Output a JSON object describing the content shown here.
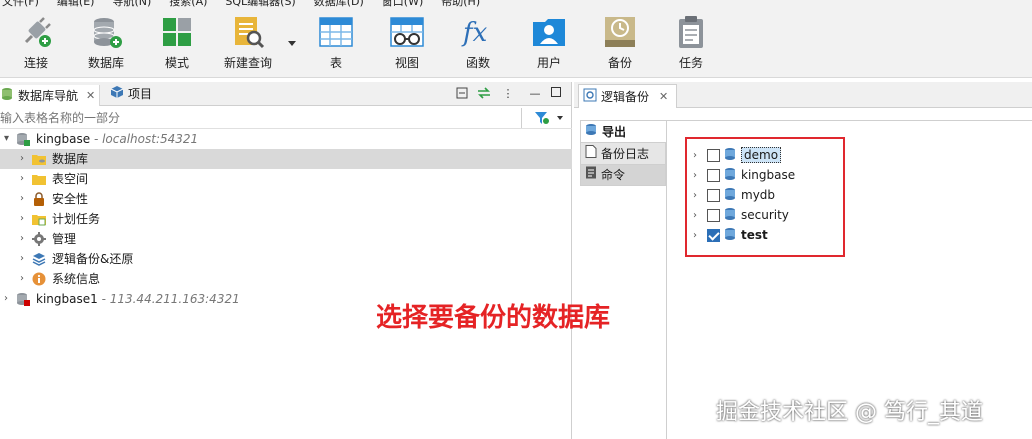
{
  "menubar": {
    "items": [
      "文件(F)",
      "编辑(E)",
      "导航(N)",
      "搜索(A)",
      "SQL编辑器(S)",
      "数据库(D)",
      "窗口(W)",
      "帮助(H)"
    ]
  },
  "toolbar": {
    "connect": "连接",
    "database": "数据库",
    "schema": "模式",
    "new_query": "新建查询",
    "table": "表",
    "view": "视图",
    "function": "函数",
    "user": "用户",
    "backup": "备份",
    "task": "任务"
  },
  "navigator": {
    "tab_label": "数据库导航",
    "tab2_label": "项目",
    "filter_placeholder": "输入表格名称的一部分",
    "tree": [
      {
        "label": "kingbase",
        "host": " - localhost:54321"
      },
      {
        "label": "数据库"
      },
      {
        "label": "表空间"
      },
      {
        "label": "安全性"
      },
      {
        "label": "计划任务"
      },
      {
        "label": "管理"
      },
      {
        "label": "逻辑备份&还原"
      },
      {
        "label": "系统信息"
      },
      {
        "label": "kingbase1",
        "host": " - 113.44.211.163:4321"
      }
    ]
  },
  "editor": {
    "tab_label": "逻辑备份",
    "side_tabs": [
      "导出",
      "备份日志",
      "命令"
    ],
    "databases": [
      {
        "name": "demo",
        "checked": false
      },
      {
        "name": "kingbase",
        "checked": false
      },
      {
        "name": "mydb",
        "checked": false
      },
      {
        "name": "security",
        "checked": false
      },
      {
        "name": "test",
        "checked": true
      }
    ]
  },
  "annotation": "选择要备份的数据库",
  "watermark": "掘金技术社区 @ 笃行_其道",
  "colors": {
    "highlight_red": "#e0282e",
    "checkbox_blue": "#2c6fb7",
    "selection_gray": "#d9d9d9"
  }
}
